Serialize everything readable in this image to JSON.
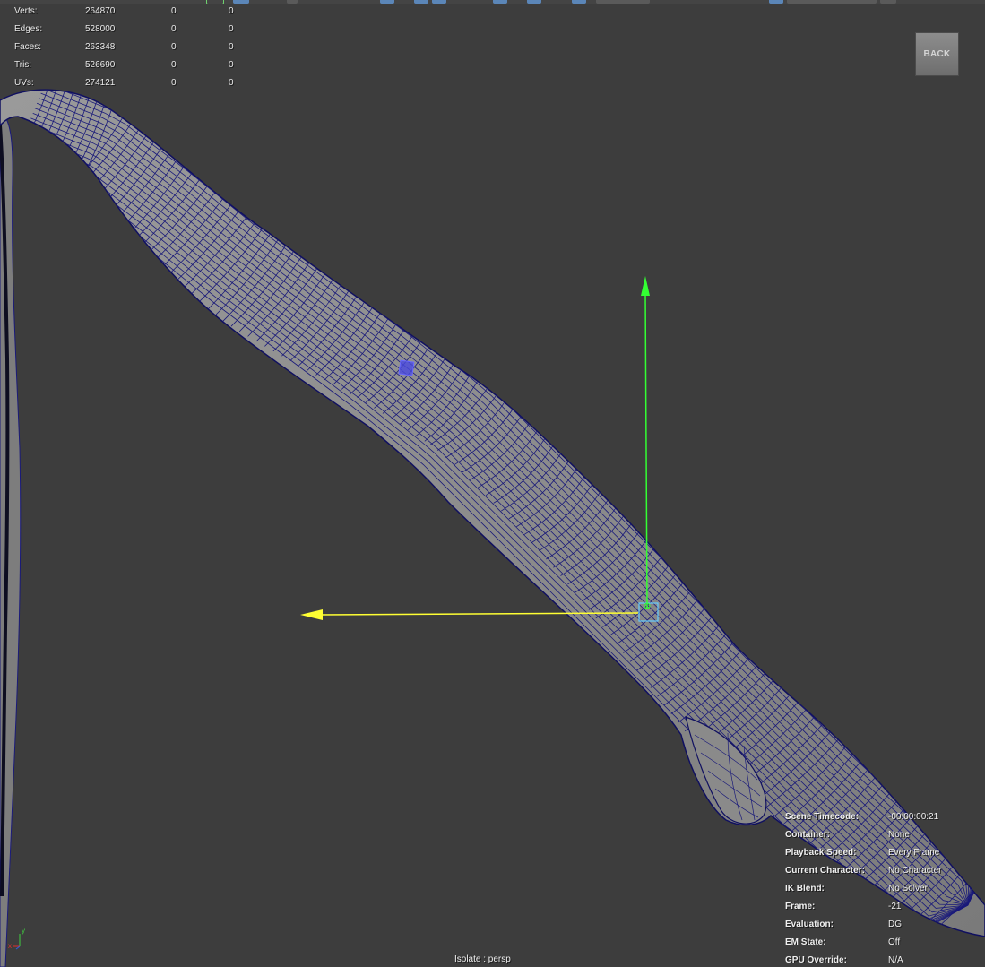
{
  "viewport": {
    "background": "#3d3d3d",
    "mesh_wire_color": "#1a1a7a",
    "mesh_fill_color": "#8c8c8c"
  },
  "hud_stats": {
    "rows": [
      {
        "label": "Verts:",
        "v1": "264870",
        "v2": "0",
        "v3": "0"
      },
      {
        "label": "Edges:",
        "v1": "528000",
        "v2": "0",
        "v3": "0"
      },
      {
        "label": "Faces:",
        "v1": "263348",
        "v2": "0",
        "v3": "0"
      },
      {
        "label": "Tris:",
        "v1": "526690",
        "v2": "0",
        "v3": "0"
      },
      {
        "label": "UVs:",
        "v1": "274121",
        "v2": "0",
        "v3": "0"
      }
    ]
  },
  "back_button": {
    "label": "BACK"
  },
  "hud_info": {
    "rows": [
      {
        "label": "Scene Timecode:",
        "value": "-00:00:00:21"
      },
      {
        "label": "Container:",
        "value": "None"
      },
      {
        "label": "Playback Speed:",
        "value": "Every Frame"
      },
      {
        "label": "Current Character:",
        "value": "No Character"
      },
      {
        "label": "IK Blend:",
        "value": "No Solver"
      },
      {
        "label": "Frame:",
        "value": "-21"
      },
      {
        "label": "Evaluation:",
        "value": "DG"
      },
      {
        "label": "EM State:",
        "value": "Off"
      },
      {
        "label": "GPU Override:",
        "value": "N/A"
      }
    ]
  },
  "isolate": {
    "label": "Isolate : persp"
  },
  "axis_triad": {
    "x_label": "x",
    "y_label": "y",
    "x_color": "#e03030",
    "y_color": "#40d040",
    "z_color": "#3060e0"
  },
  "manipulator": {
    "y_axis_color": "#33ff33",
    "x_axis_color": "#ffff33",
    "center_color": "#66ccff"
  }
}
